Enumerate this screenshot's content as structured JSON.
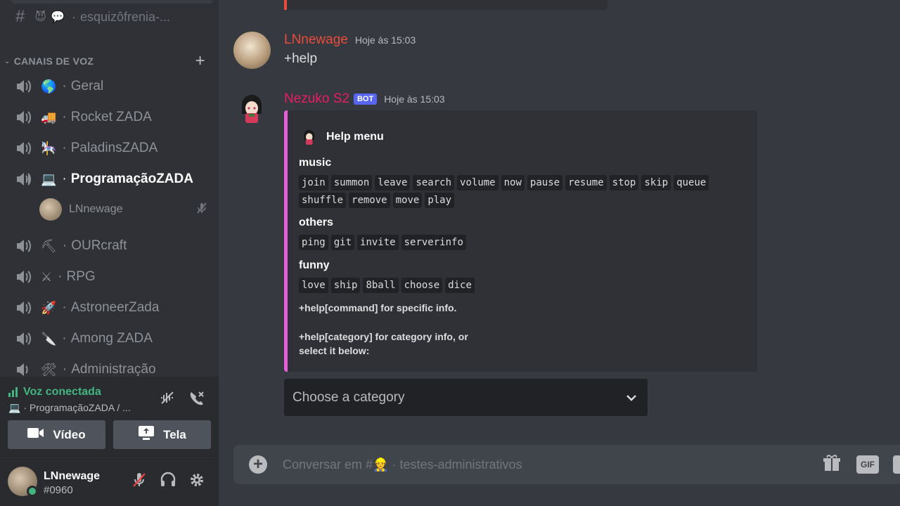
{
  "sidebar": {
    "top_channel": {
      "emoji1": "😈",
      "emoji2": "💬",
      "name": "esquizôfrenia-..."
    },
    "category": {
      "label": "CANAIS DE VOZ"
    },
    "voice_channels": [
      {
        "emoji": "🌎",
        "name": "Geral"
      },
      {
        "emoji": "🚚",
        "name": "Rocket ZADA"
      },
      {
        "emoji": "🎠",
        "name": "PaladinsZADA"
      },
      {
        "emoji": "💻",
        "name": "ProgramaçãoZADA"
      },
      {
        "emoji": "⛏",
        "name": "OURcraft"
      },
      {
        "emoji": "⚔",
        "name": "RPG"
      },
      {
        "emoji": "🚀",
        "name": "AstroneerZada"
      },
      {
        "emoji": "🔪",
        "name": "Among ZADA"
      },
      {
        "emoji": "🛠",
        "name": "Administração"
      }
    ],
    "voice_user": {
      "name": "LNnewage"
    }
  },
  "voice_panel": {
    "status": "Voz conectada",
    "channel": "💻 · ProgramaçãoZADA / ...",
    "video_label": "Vídeo",
    "screen_label": "Tela"
  },
  "user_panel": {
    "name": "LNnewage",
    "tag": "#0960"
  },
  "messages": [
    {
      "author": "LNnewage",
      "author_color": "#e74c3c",
      "time": "Hoje às 15:03",
      "text": "+help"
    },
    {
      "author": "Nezuko S2",
      "author_color": "#e91e63",
      "bot_tag": "BOT",
      "time": "Hoje às 15:03"
    }
  ],
  "embed": {
    "color": "#e85ed9",
    "author": "Help menu",
    "fields": [
      {
        "name": "music",
        "commands": [
          "join",
          "summon",
          "leave",
          "search",
          "volume",
          "now",
          "pause",
          "resume",
          "stop",
          "skip",
          "queue",
          "shuffle",
          "remove",
          "move",
          "play"
        ]
      },
      {
        "name": "others",
        "commands": [
          "ping",
          "git",
          "invite",
          "serverinfo"
        ]
      },
      {
        "name": "funny",
        "commands": [
          "love",
          "ship",
          "8ball",
          "choose",
          "dice"
        ]
      }
    ],
    "footer_line1": "+help[command] for specific info.",
    "footer_line2": "+help[category] for category info, or",
    "footer_line3": "select it below:"
  },
  "select_menu": {
    "placeholder": "Choose a category"
  },
  "composer": {
    "prefix": "Conversar em #",
    "emoji": "👷",
    "channel": "· testes-administrativos",
    "gif_label": "GIF"
  }
}
